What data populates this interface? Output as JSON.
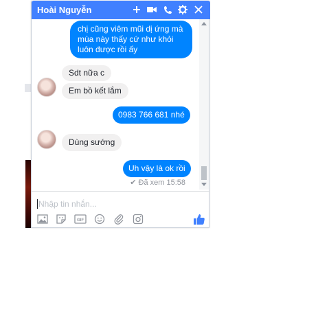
{
  "chat": {
    "title": "Hoài Nguyễn",
    "header_icons": [
      "plus-icon",
      "video-icon",
      "phone-icon",
      "gear-icon",
      "close-icon"
    ],
    "messages": [
      {
        "direction": "outgoing",
        "text": "chị cũng viêm mũi dị ứng mà mùa này thấy cứ như khỏi luôn được rồi ấy"
      },
      {
        "direction": "incoming",
        "text": "Sdt nữa c"
      },
      {
        "direction": "incoming",
        "text": "Em bồ kết lắm"
      },
      {
        "direction": "outgoing",
        "text": "0983 766 681 nhé"
      },
      {
        "direction": "incoming",
        "text": "Dùng sướng"
      },
      {
        "direction": "outgoing",
        "text": "Uh vậy là ok rồi"
      }
    ],
    "seen_status": "Đã xem 15:58",
    "composer": {
      "placeholder": "Nhập tin nhắn...",
      "icons": [
        "photo-icon",
        "sticker-icon",
        "gif-icon",
        "emoji-icon",
        "attachment-icon",
        "camera-icon",
        "like-icon"
      ]
    }
  },
  "colors": {
    "header": "#4080ff",
    "outgoing_bubble": "#0084ff",
    "incoming_bubble": "#f1f0f0",
    "like": "#4080ff"
  }
}
